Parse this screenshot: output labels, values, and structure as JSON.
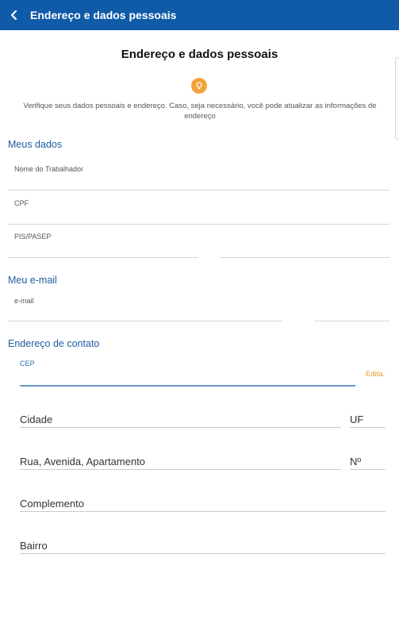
{
  "appbar": {
    "title": "Endereço e dados pessoais"
  },
  "page": {
    "title": "Endereço e dados pessoais",
    "intro_line1": "Verifique seus dados pessoais e endereço. Caso, seja necessário, você pode atualizar as informações de",
    "intro_line2": "endereço"
  },
  "meus_dados": {
    "title": "Meus dados",
    "nome_label": "Nome do Trabalhador",
    "cpf_label": "CPF",
    "pis_label": "PIS/PASEP"
  },
  "email": {
    "title": "Meu e-mail",
    "label": "e-mail"
  },
  "endereco": {
    "title": "Endereço de contato",
    "cep_label": "CEP",
    "edit_label": "Edita.",
    "cidade_label": "Cidade",
    "uf_label": "UF",
    "rua_label": "Rua, Avenida, Apartamento",
    "numero_label": "Nº",
    "complemento_label": "Complemento",
    "bairro_label": "Bairro"
  },
  "colors": {
    "appbar": "#0f5ba8",
    "section_title": "#1c5d9e",
    "accent_orange": "#f2a33a"
  },
  "icons": {
    "back": "chevron-left-icon",
    "info": "lightbulb-icon"
  }
}
